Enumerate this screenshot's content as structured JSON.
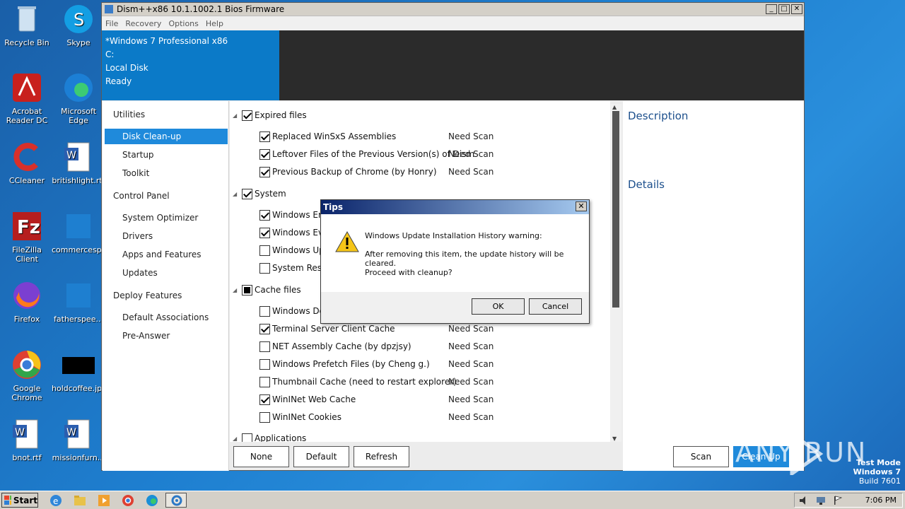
{
  "desktop": {
    "icons": [
      {
        "label": "Recycle Bin"
      },
      {
        "label": "Skype"
      },
      {
        "label": "Acrobat Reader DC"
      },
      {
        "label": "Microsoft Edge"
      },
      {
        "label": "CCleaner"
      },
      {
        "label": "britishlight.rtf"
      },
      {
        "label": "FileZilla Client"
      },
      {
        "label": "commercesp..."
      },
      {
        "label": "Firefox"
      },
      {
        "label": "fatherspee..."
      },
      {
        "label": "Google Chrome"
      },
      {
        "label": "holdcoffee.jpg"
      },
      {
        "label": "bnot.rtf"
      },
      {
        "label": "missionfurn..."
      }
    ]
  },
  "window": {
    "title": "Dism++x86 10.1.1002.1 Bios Firmware",
    "minimize": "_",
    "maximize": "□",
    "close": "✕",
    "menu": [
      "File",
      "Recovery",
      "Options",
      "Help"
    ],
    "header": {
      "os": "*Windows 7 Professional x86",
      "drive": "C:",
      "disk": "Local Disk",
      "state": "Ready"
    },
    "sidebar": [
      {
        "label": "Utilities",
        "kind": "group"
      },
      {
        "label": "Disk Clean-up",
        "kind": "active"
      },
      {
        "label": "Startup",
        "kind": "sub"
      },
      {
        "label": "Toolkit",
        "kind": "sub"
      },
      {
        "label": "Control Panel",
        "kind": "group"
      },
      {
        "label": "System Optimizer",
        "kind": "sub"
      },
      {
        "label": "Drivers",
        "kind": "sub"
      },
      {
        "label": "Apps and Features",
        "kind": "sub"
      },
      {
        "label": "Updates",
        "kind": "sub"
      },
      {
        "label": "Deploy Features",
        "kind": "group"
      },
      {
        "label": "Default Associations",
        "kind": "sub"
      },
      {
        "label": "Pre-Answer",
        "kind": "sub"
      }
    ],
    "tree": [
      {
        "label": "Expired files",
        "level": 0,
        "check": "on",
        "status": ""
      },
      {
        "label": "Replaced WinSxS Assemblies",
        "level": 1,
        "check": "on",
        "status": "Need Scan"
      },
      {
        "label": "Leftover Files of the Previous Version(s) of Dism",
        "level": 1,
        "check": "on",
        "status": "Need Scan"
      },
      {
        "label": "Previous Backup of Chrome (by Honry)",
        "level": 1,
        "check": "on",
        "status": "Need Scan"
      },
      {
        "label": "System",
        "level": 0,
        "check": "on",
        "status": ""
      },
      {
        "label": "Windows Err",
        "level": 1,
        "check": "on",
        "status": ""
      },
      {
        "label": "Windows Eve",
        "level": 1,
        "check": "on",
        "status": ""
      },
      {
        "label": "Windows Up",
        "level": 1,
        "check": "off",
        "status": ""
      },
      {
        "label": "System Resto",
        "level": 1,
        "check": "off",
        "status": ""
      },
      {
        "label": "Cache files",
        "level": 0,
        "check": "partial",
        "status": ""
      },
      {
        "label": "Windows Do",
        "level": 1,
        "check": "off",
        "status": ""
      },
      {
        "label": "Terminal Server Client Cache",
        "level": 1,
        "check": "on",
        "status": "Need Scan"
      },
      {
        "label": "NET Assembly Cache (by dpzjsy)",
        "level": 1,
        "check": "off",
        "status": "Need Scan"
      },
      {
        "label": "Windows Prefetch Files (by Cheng g.)",
        "level": 1,
        "check": "off",
        "status": "Need Scan"
      },
      {
        "label": "Thumbnail Cache (need to restart explorer)",
        "level": 1,
        "check": "off",
        "status": "Need Scan"
      },
      {
        "label": "WinINet Web Cache",
        "level": 1,
        "check": "on",
        "status": "Need Scan"
      },
      {
        "label": "WinINet Cookies",
        "level": 1,
        "check": "off",
        "status": "Need Scan"
      },
      {
        "label": "Applications",
        "level": 0,
        "check": "off",
        "status": ""
      }
    ],
    "description": {
      "heading": "Description",
      "details": "Details"
    },
    "buttons": {
      "none": "None",
      "default": "Default",
      "refresh": "Refresh",
      "scan": "Scan",
      "cleanup": "Clean Up"
    }
  },
  "dialog": {
    "title": "Tips",
    "close": "✕",
    "line1": "Windows Update Installation History warning:",
    "line2": "After removing this item, the update history will be cleared.",
    "line3": "Proceed with cleanup?",
    "ok": "OK",
    "cancel": "Cancel"
  },
  "taskbar": {
    "start": "Start",
    "clock": "7:06 PM"
  },
  "watermark": {
    "brand": "ANY RUN",
    "mode": "Test Mode",
    "os": "Windows 7",
    "build": "Build 7601"
  },
  "colors": {
    "accent": "#1f8adb",
    "header": "#0b7ac8",
    "desktop": "#1e7fd0"
  }
}
